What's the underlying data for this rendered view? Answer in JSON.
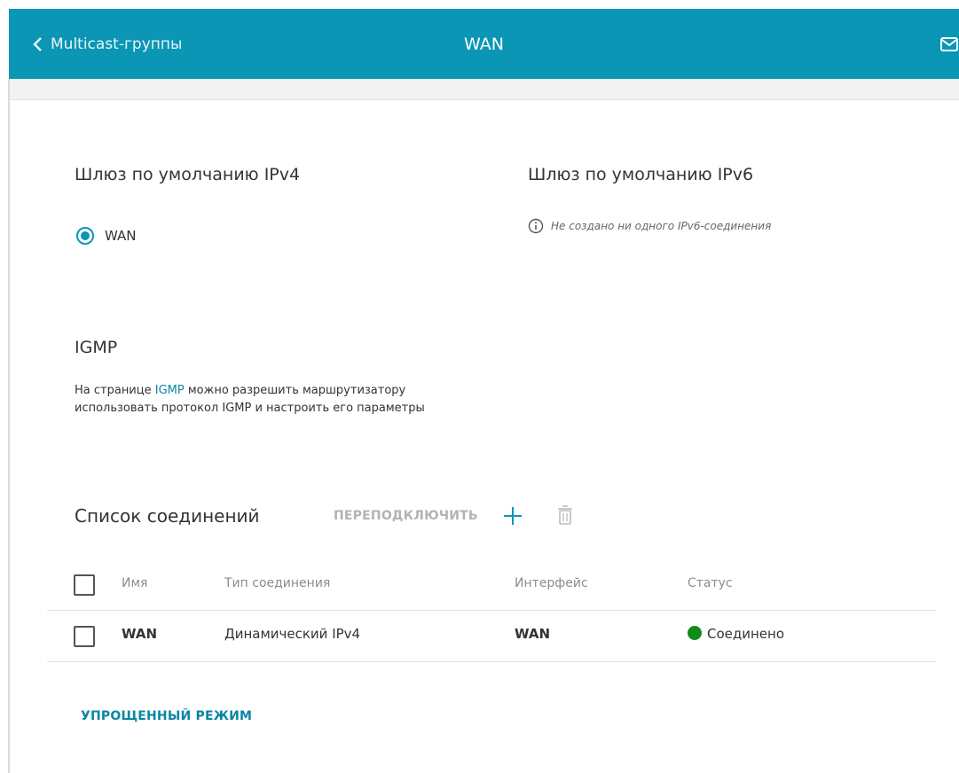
{
  "header": {
    "back_label": "Multicast-группы",
    "title": "WAN"
  },
  "ipv4": {
    "title": "Шлюз по умолчанию IPv4",
    "option_label": "WAN"
  },
  "ipv6": {
    "title": "Шлюз по умолчанию IPv6",
    "info": "Не создано ни одного IPv6-соединения"
  },
  "igmp": {
    "title": "IGMP",
    "desc_before": "На странице ",
    "link": "IGMP",
    "desc_after": " можно разрешить маршрутизатору использовать протокол IGMP и настроить его параметры"
  },
  "connections": {
    "title": "Список соединений",
    "reconnect_label": "ПЕРЕПОДКЛЮЧИТЬ",
    "columns": [
      "Имя",
      "Тип соединения",
      "Интерфейс",
      "Статус"
    ],
    "rows": [
      {
        "name": "WAN",
        "type": "Динамический IPv4",
        "interface": "WAN",
        "status": "Соединено"
      }
    ]
  },
  "footer": {
    "simple_mode_label": "УПРОЩЕННЫЙ РЕЖИМ"
  },
  "colors": {
    "accent": "#0a96b4",
    "status_ok": "#128a19"
  }
}
